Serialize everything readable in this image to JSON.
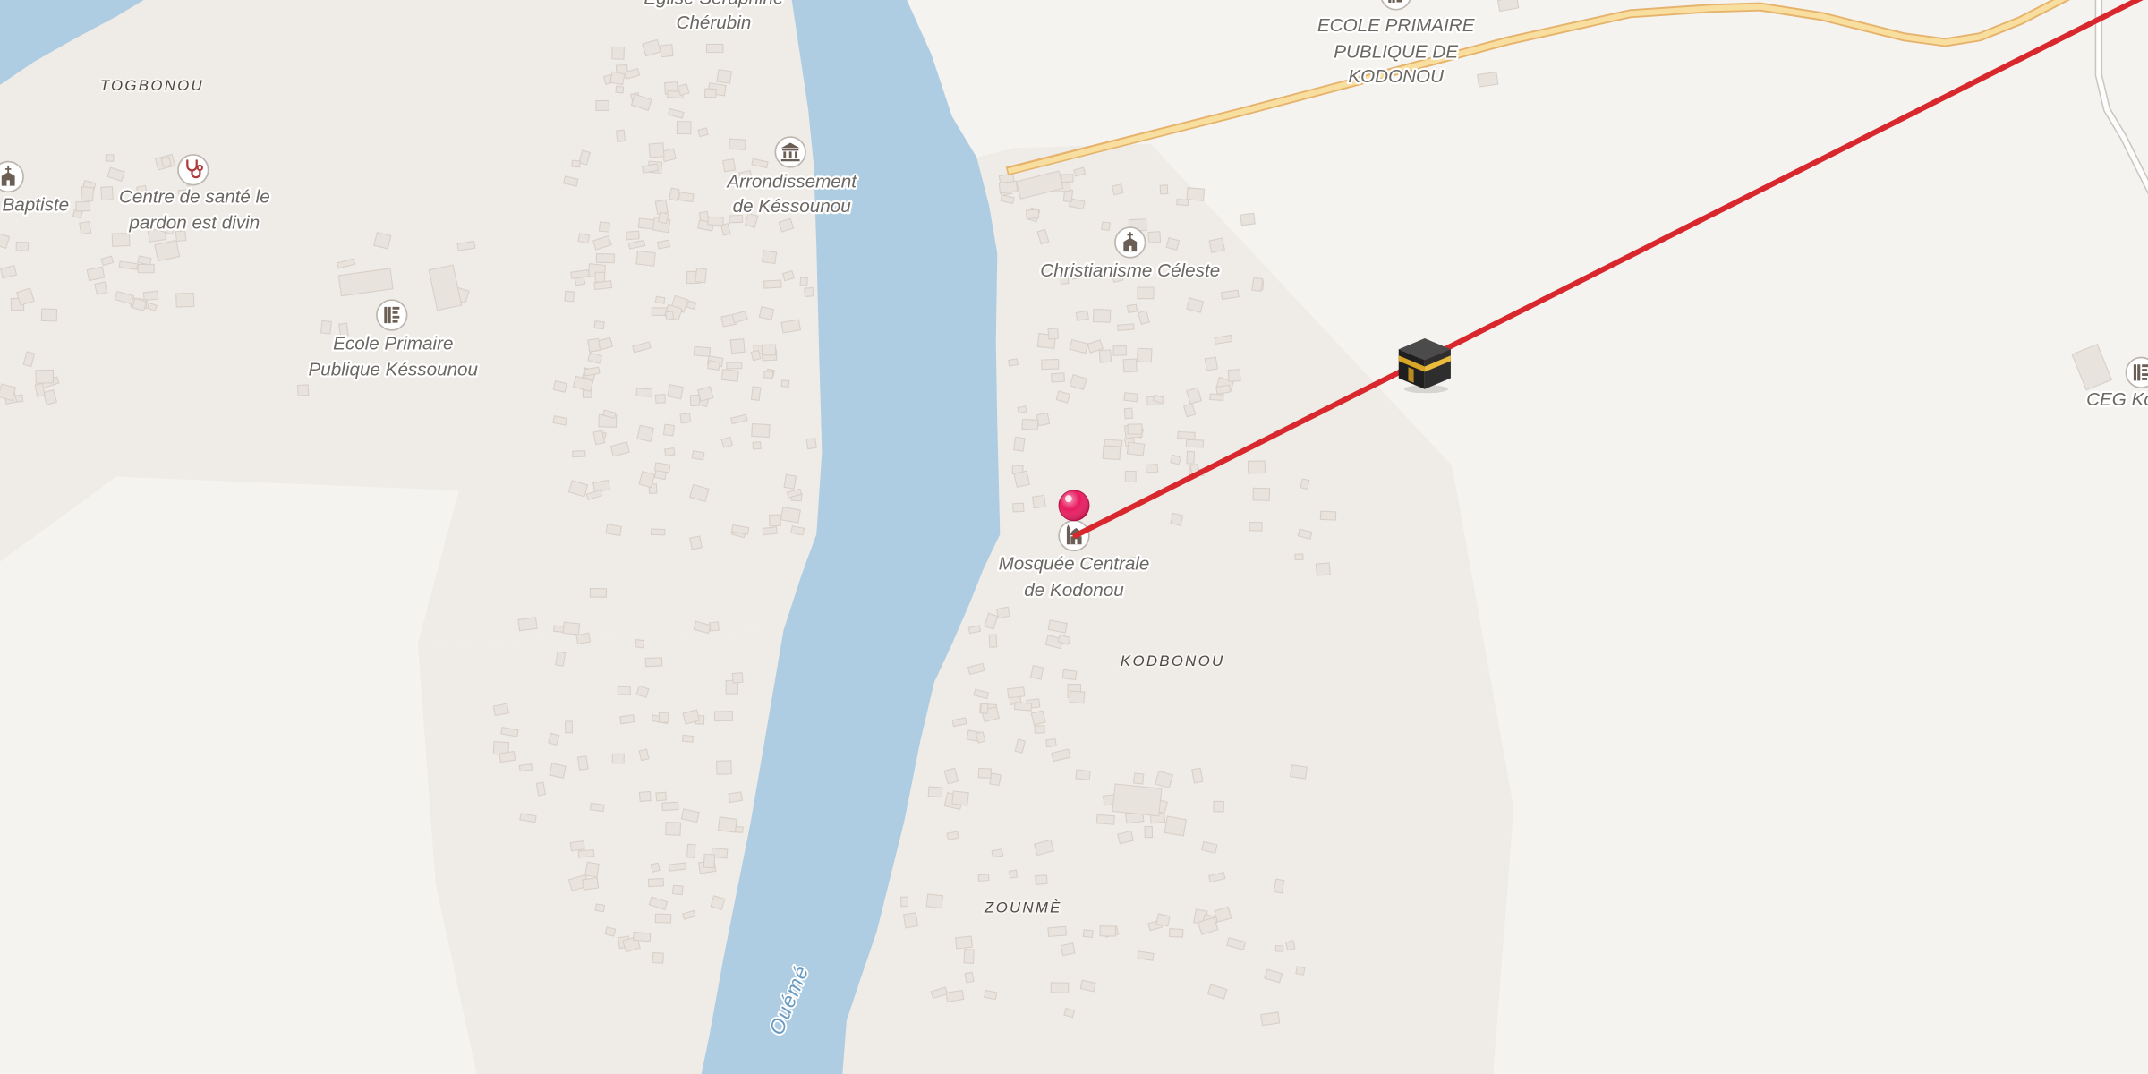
{
  "map": {
    "water": {
      "name": "Ouémé"
    },
    "places": {
      "togbonou": "TOGBONOU",
      "kodbonou": "KODBONOU",
      "zounme": "ZOUNMÈ"
    },
    "pois": {
      "eglise_seraphine": {
        "line1": "Eglise Séraphine",
        "line2": "Chérubin"
      },
      "eglise_baptiste": {
        "label": "Baptiste",
        "icon": "church-icon"
      },
      "centre_sante": {
        "line1": "Centre de santé le",
        "line2": "pardon est divin",
        "icon": "stethoscope-icon"
      },
      "ecole_kessounou": {
        "line1": "Ecole Primaire",
        "line2": "Publique Késsounou",
        "icon": "school-icon"
      },
      "arrondissement": {
        "line1": "Arrondissement",
        "line2": "de Késsounou",
        "icon": "town-hall-icon"
      },
      "christianisme_celeste": {
        "label": "Christianisme Céleste",
        "icon": "church-icon"
      },
      "mosquee_centrale": {
        "line1": "Mosquée Centrale",
        "line2": "de Kodonou",
        "icon": "mosque-icon"
      },
      "ecole_kodonou": {
        "line1": "ECOLE PRIMAIRE",
        "line2": "PUBLIQUE DE",
        "line3": "KODONOU",
        "icon": "school-icon"
      },
      "ceg": {
        "label": "CEG Ko",
        "icon": "school-icon"
      }
    },
    "markers": {
      "selected_location": {
        "icon": "map-pin-icon",
        "color": "#e8195f"
      },
      "qibla_target": {
        "icon": "kaaba-icon"
      }
    },
    "qibla_line": {
      "color": "#d8272d"
    }
  },
  "colors": {
    "land": "#f5f3f0",
    "landuse": "#efebe6",
    "water": "#aecce2",
    "road_fill": "#f9df9f",
    "road_casing": "#e6b36c",
    "minor_road_fill": "#fdfdfd",
    "minor_road_casing": "#cbc5be",
    "building": "#e8e3dd",
    "poi_icon": "#6b5e55",
    "health_icon": "#b0393a"
  }
}
